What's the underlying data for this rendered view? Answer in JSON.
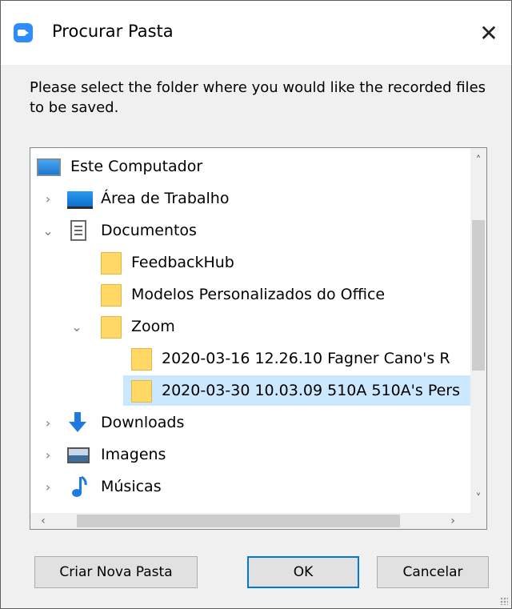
{
  "window": {
    "title": "Procurar Pasta",
    "close_glyph": "✕"
  },
  "prompt": "Please select the folder where you would like the recorded files to be saved.",
  "tree": {
    "items": [
      {
        "label": "Este Computador",
        "icon": "computer-icon",
        "expander": "",
        "level": 0
      },
      {
        "label": "Área de Trabalho",
        "icon": "desktop-icon",
        "expander": "›",
        "level": 1
      },
      {
        "label": "Documentos",
        "icon": "documents-icon",
        "expander": "⌄",
        "level": 1
      },
      {
        "label": "FeedbackHub",
        "icon": "folder-icon",
        "expander": "",
        "level": 2
      },
      {
        "label": "Modelos Personalizados do Office",
        "icon": "folder-icon",
        "expander": "",
        "level": 2
      },
      {
        "label": "Zoom",
        "icon": "folder-icon",
        "expander": "⌄",
        "level": 2
      },
      {
        "label": "2020-03-16 12.26.10 Fagner Cano's R",
        "icon": "folder-icon",
        "expander": "",
        "level": 3
      },
      {
        "label": "2020-03-30 10.03.09 510A 510A's Pers",
        "icon": "folder-icon",
        "expander": "",
        "level": 3,
        "selected": true
      },
      {
        "label": "Downloads",
        "icon": "downloads-icon",
        "expander": "›",
        "level": 1
      },
      {
        "label": "Imagens",
        "icon": "images-icon",
        "expander": "›",
        "level": 1
      },
      {
        "label": "Músicas",
        "icon": "music-icon",
        "expander": "›",
        "level": 1
      }
    ],
    "scroll_up": "˄",
    "scroll_down": "˅",
    "scroll_left": "‹",
    "scroll_right": "›"
  },
  "buttons": {
    "new_folder": "Criar Nova Pasta",
    "ok": "OK",
    "cancel": "Cancelar"
  },
  "colors": {
    "selection": "#cce8ff",
    "default_button_border": "#0078d7",
    "folder": "#ffd866"
  }
}
